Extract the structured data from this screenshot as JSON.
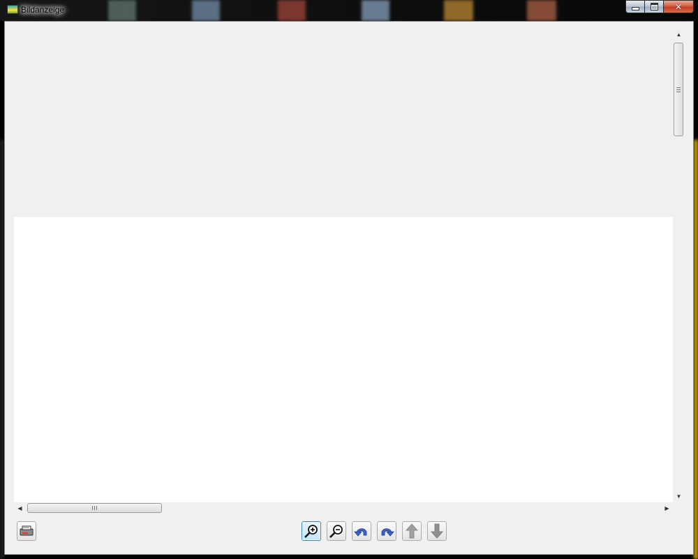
{
  "window": {
    "title": "Bildanzeige",
    "controls": [
      "minimize",
      "maximize",
      "close"
    ]
  },
  "toolbar": {
    "buttons": [
      {
        "name": "scanner-button",
        "icon": "scanner-icon",
        "enabled": true
      },
      {
        "name": "zoom-in-button",
        "icon": "zoom-in-icon",
        "enabled": true,
        "active": true
      },
      {
        "name": "zoom-out-button",
        "icon": "zoom-out-icon",
        "enabled": true
      },
      {
        "name": "rotate-left-button",
        "icon": "rotate-left-icon",
        "enabled": true
      },
      {
        "name": "rotate-right-button",
        "icon": "rotate-right-icon",
        "enabled": true
      },
      {
        "name": "previous-page-button",
        "icon": "arrow-up-icon",
        "enabled": false
      },
      {
        "name": "next-page-button",
        "icon": "arrow-down-icon",
        "enabled": false
      }
    ]
  },
  "colors": {
    "accent": "#3c64c8",
    "window_bg": "#f0f0f0",
    "image_bg": "#ffffff"
  }
}
